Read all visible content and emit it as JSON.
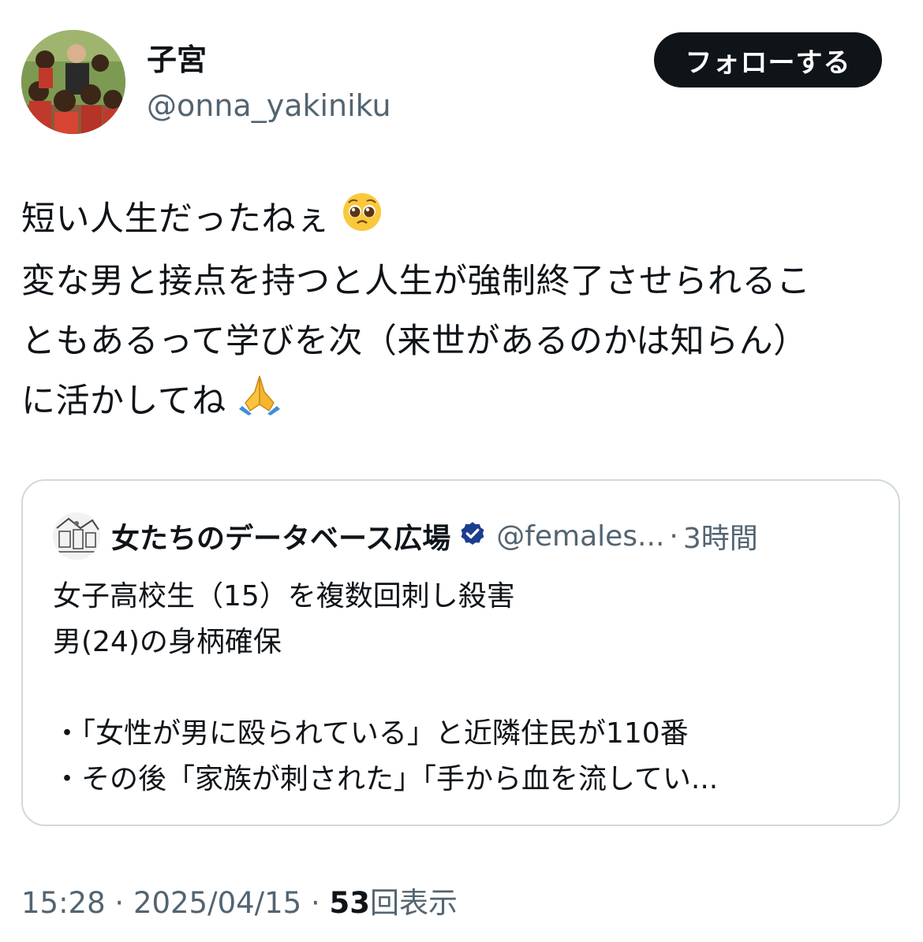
{
  "author": {
    "display_name": "子宮",
    "handle": "@onna_yakiniku"
  },
  "follow_button": {
    "label": "フォローする"
  },
  "tweet": {
    "lines": [
      "短い人生だったねぇ",
      "変な男と接点を持つと人生が強制終了させられるこ",
      "ともあるって学びを次（来世があるのかは知らん）",
      "に活かしてね"
    ],
    "emojis": [
      "pleading-face-emoji",
      "folded-hands-emoji"
    ]
  },
  "quote": {
    "display_name": "女たちのデータベース広場",
    "handle": "@females...",
    "separator": "·",
    "time": "3時間",
    "verified_icon": "verified-badge-icon",
    "verified_color": "#1d3d8f",
    "lines": [
      "女子高校生（15）を複数回刺し殺害",
      "男(24)の身柄確保",
      "",
      "・「女性が男に殴られている」と近隣住民が110番",
      "・その後「家族が刺された」「手から血を流してい..."
    ]
  },
  "meta": {
    "time": "15:28",
    "sep": "·",
    "date": "2025/04/15",
    "views_count": "53",
    "views_label": "回表示"
  },
  "colors": {
    "text": "#0f1419",
    "secondary": "#536471",
    "border": "#cfd9de",
    "button_bg": "#0f1419"
  }
}
